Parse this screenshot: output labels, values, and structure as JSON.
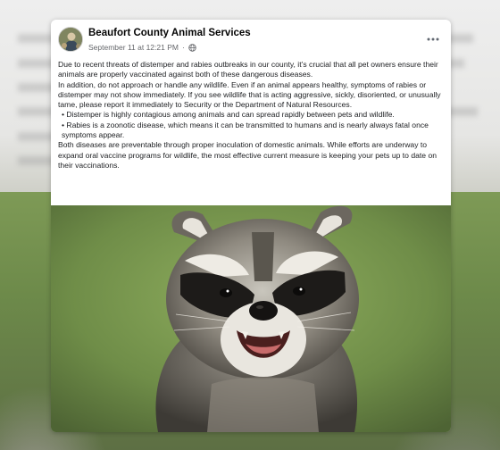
{
  "post": {
    "page_name": "Beaufort County Animal Services",
    "timestamp": "September 11 at 12:21 PM",
    "separator": "·",
    "privacy_icon": "globe-icon",
    "more_icon": "more-options-icon",
    "paragraphs": [
      "Due to recent threats of distemper and rabies outbreaks in our county, it’s crucial that all pet owners ensure their animals are properly vaccinated against both of these dangerous diseases.",
      "In addition, do not approach or handle any wildlife. Even if an animal appears healthy, symptoms of rabies or distemper may not show immediately. If you see wildlife that is acting aggressive, sickly, disoriented, or unusually tame, please report it immediately to Security or the Department of Natural Resources.",
      "• Distemper is highly contagious among animals and can spread rapidly between pets and wildlife.",
      "• Rabies is a zoonotic disease, which means it can be transmitted to humans and is nearly always fatal once symptoms appear.",
      "Both diseases are preventable through proper inoculation of domestic animals. While efforts are underway to expand oral vaccine programs for wildlife, the most effective current measure is keeping your pets up to date on their vaccinations."
    ],
    "image_subject": "raccoon-photo"
  },
  "colors": {
    "name_text": "#050505",
    "meta_text": "#65676b",
    "body_text": "#1c1e21",
    "card_bg": "#ffffff"
  }
}
